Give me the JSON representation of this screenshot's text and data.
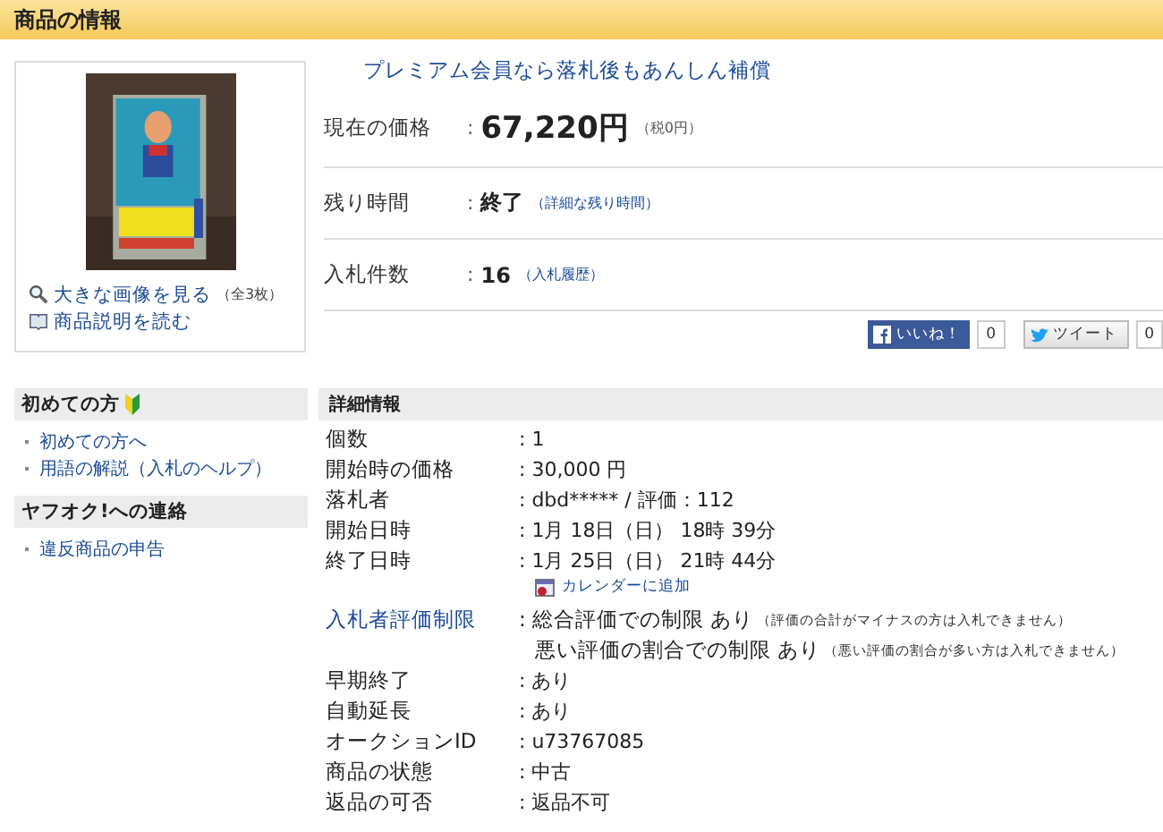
{
  "header": {
    "title": "商品の情報"
  },
  "image_card": {
    "links": [
      {
        "kind": "zoom",
        "text": "大きな画像を見る",
        "note": "（全3枚）"
      },
      {
        "kind": "book",
        "text": "商品説明を読む"
      }
    ]
  },
  "premium_link": "プレミアム会員なら落札後もあんしん補償",
  "summary": [
    {
      "kind": "price",
      "label": "現在の価格",
      "separator": ":",
      "value": "67,220円",
      "note": "（税0円）"
    },
    {
      "kind": "time",
      "label": "残り時間",
      "separator": ":",
      "value": "終了",
      "note": "（詳細な残り時間）"
    },
    {
      "kind": "bids",
      "label": "入札件数",
      "separator": ":",
      "value": "16",
      "note": "（入札履歴）"
    }
  ],
  "social": {
    "like": "いいね！",
    "like_count": "0",
    "tweet": "ツイート",
    "tweet_count": "0"
  },
  "sidebar": [
    {
      "title": "初めての方",
      "badge": true,
      "links": [
        "初めての方へ",
        "用語の解説（入札のヘルプ）"
      ]
    },
    {
      "title": "ヤフオク!への連絡",
      "badge": false,
      "links": [
        "違反商品の申告"
      ]
    }
  ],
  "details": {
    "title": "詳細情報",
    "rows": [
      {
        "label": "個数",
        "link": false,
        "lines": [
          {
            "text": ": 1"
          }
        ]
      },
      {
        "label": "開始時の価格",
        "link": false,
        "lines": [
          {
            "text": ": 30,000 円"
          }
        ]
      },
      {
        "label": "落札者",
        "link": false,
        "lines": [
          {
            "text": ": dbd***** / 評価：112"
          }
        ]
      },
      {
        "label": "開始日時",
        "link": false,
        "lines": [
          {
            "text": ": 1月 18日（日） 18時 39分"
          }
        ]
      },
      {
        "label": "終了日時",
        "link": false,
        "lines": [
          {
            "text": ": 1月 25日（日） 21時 44分"
          }
        ],
        "calendar": "カレンダーに追加"
      },
      {
        "label": "入札者評価制限",
        "link": true,
        "lines": [
          {
            "text": ": 総合評価での制限 あり",
            "note": "（評価の合計がマイナスの方は入札できません）"
          },
          {
            "text": "悪い評価の割合での制限 あり",
            "note": "（悪い評価の割合が多い方は入札できません）"
          }
        ]
      },
      {
        "label": "早期終了",
        "link": false,
        "lines": [
          {
            "text": ": あり"
          }
        ]
      },
      {
        "label": "自動延長",
        "link": false,
        "lines": [
          {
            "text": ": あり"
          }
        ]
      },
      {
        "label": "オークションID",
        "link": false,
        "lines": [
          {
            "text": ": u73767085"
          }
        ]
      },
      {
        "label": "商品の状態",
        "link": false,
        "lines": [
          {
            "text": ": 中古"
          }
        ]
      },
      {
        "label": "返品の可否",
        "link": false,
        "lines": [
          {
            "text": ": 返品不可"
          }
        ]
      }
    ]
  }
}
